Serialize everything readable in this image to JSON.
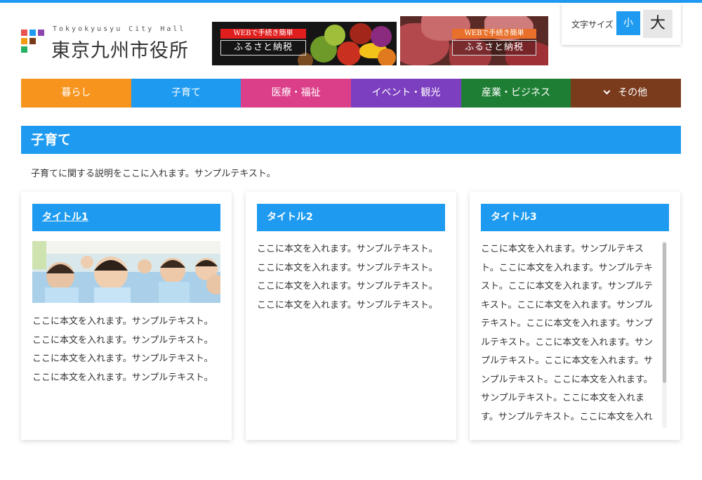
{
  "header": {
    "logo_sub": "Tokyokyusyu City Hall",
    "logo_main": "東京九州市役所",
    "logo_colors": [
      "#e8524f",
      "#1e9bf0",
      "#8e44ad",
      "#f39c12",
      "#27ae60",
      "#2ecc71",
      "#e67e22"
    ]
  },
  "banners": [
    {
      "web_label": "WEBで手続き簡単",
      "main_label": "ふるさと納税",
      "accent": "#e01e1e"
    },
    {
      "web_label": "WEBで手続き簡単",
      "main_label": "ふるさと納税",
      "accent": "#e8702a"
    }
  ],
  "font_size": {
    "label": "文字サイズ",
    "small": "小",
    "large": "大"
  },
  "nav": [
    {
      "label": "暮らし",
      "color": "#f7941d"
    },
    {
      "label": "子育て",
      "color": "#1e9bf0"
    },
    {
      "label": "医療・福祉",
      "color": "#dc3f8a"
    },
    {
      "label": "イベント・観光",
      "color": "#7b3fbf"
    },
    {
      "label": "産業・ビジネス",
      "color": "#1e7f34"
    },
    {
      "label": "その他",
      "color": "#7a3a1c",
      "icon": "chevron-down-icon"
    }
  ],
  "section": {
    "title": "子育て",
    "description": "子育てに関する説明をここに入れます。サンプルテキスト。"
  },
  "cards": [
    {
      "title": "タイトル1",
      "lines": [
        "ここに本文を入れます。サンプルテキスト。",
        "ここに本文を入れます。サンプルテキスト。",
        "ここに本文を入れます。サンプルテキスト。",
        "ここに本文を入れます。サンプルテキスト。"
      ]
    },
    {
      "title": "タイトル2",
      "lines": [
        "ここに本文を入れます。サンプルテキスト。",
        "ここに本文を入れます。サンプルテキスト。",
        "ここに本文を入れます。サンプルテキスト。",
        "ここに本文を入れます。サンプルテキスト。"
      ]
    },
    {
      "title": "タイトル3",
      "lines": [
        "ここに本文を入れます。サンプルテキス",
        "ト。ここに本文を入れます。サンプルテキ",
        "スト。ここに本文を入れます。サンプルテ",
        "キスト。ここに本文を入れます。サンプル",
        "テキスト。ここに本文を入れます。サンプ",
        "ルテキスト。ここに本文を入れます。サン",
        "プルテキスト。ここに本文を入れます。サ",
        "ンプルテキスト。ここに本文を入れます。",
        "サンプルテキスト。ここに本文を入れま",
        "す。サンプルテキスト。ここに本文を入れ"
      ]
    }
  ]
}
